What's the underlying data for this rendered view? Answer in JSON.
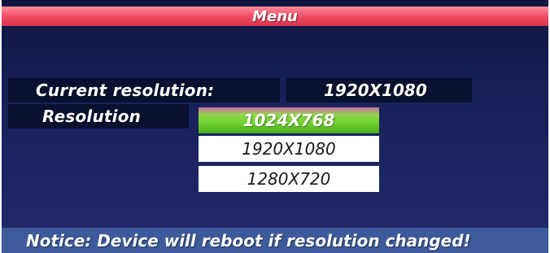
{
  "menu": {
    "title": "Menu"
  },
  "current_resolution": {
    "label": "Current resolution:",
    "value": "1920X1080"
  },
  "resolution": {
    "label": "Resolution",
    "options": [
      "1024X768",
      "1920X1080",
      "1280X720"
    ],
    "selected": "1024X768"
  },
  "notice": {
    "text": "Notice: Device will reboot if resolution changed!"
  },
  "colors": {
    "title_bar": "#f04a62",
    "background": "#1a2460",
    "selected_option": "#6fd12f",
    "notice_bar": "#3d5a9a"
  }
}
